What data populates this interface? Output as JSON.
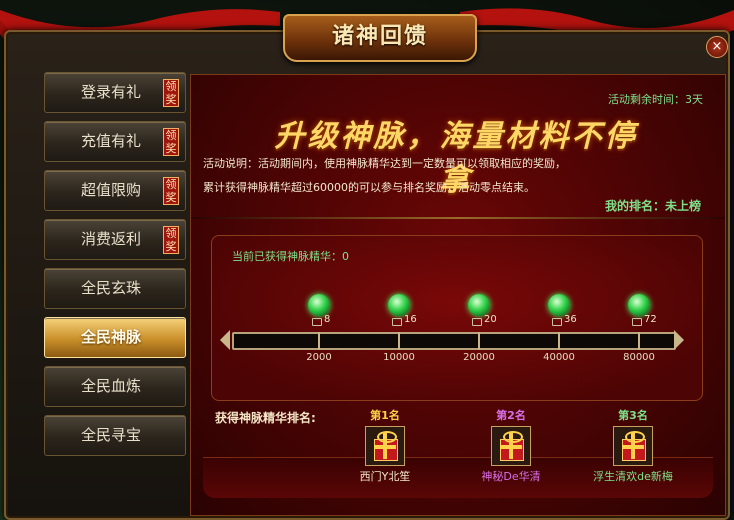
{
  "window": {
    "title": "诸神回馈",
    "close_glyph": "×"
  },
  "sidebar": {
    "items": [
      {
        "label": "登录有礼",
        "tag": "领奖",
        "active": false
      },
      {
        "label": "充值有礼",
        "tag": "领奖",
        "active": false
      },
      {
        "label": "超值限购",
        "tag": "领奖",
        "active": false
      },
      {
        "label": "消费返利",
        "tag": "领奖",
        "active": false
      },
      {
        "label": "全民玄珠",
        "tag": "",
        "active": false
      },
      {
        "label": "全民神脉",
        "tag": "",
        "active": true
      },
      {
        "label": "全民血炼",
        "tag": "",
        "active": false
      },
      {
        "label": "全民寻宝",
        "tag": "",
        "active": false
      }
    ]
  },
  "event": {
    "remaining_time": "活动剩余时间：3天",
    "slogan": "升级神脉，海量材料不停拿",
    "desc_line1": "活动说明：活动期间内，使用神脉精华达到一定数量可以领取相应的奖励，",
    "desc_line2": "累计获得神脉精华超过60000的可以参与排名奖励，活动零点结束。",
    "my_rank": "我的排名：未上榜",
    "current_label": "当前已获得神脉精华：0",
    "progress": 0,
    "milestones": [
      {
        "gem_count": "8",
        "threshold": "2000"
      },
      {
        "gem_count": "16",
        "threshold": "10000"
      },
      {
        "gem_count": "20",
        "threshold": "20000"
      },
      {
        "gem_count": "36",
        "threshold": "40000"
      },
      {
        "gem_count": "72",
        "threshold": "80000"
      }
    ]
  },
  "ranking": {
    "title": "获得神脉精华排名:",
    "slots": [
      {
        "place": "第1名",
        "player": "西门Y北笙",
        "place_color": "#ffd24a",
        "player_color": "#f3e7cc"
      },
      {
        "place": "第2名",
        "player": "神秘De华清",
        "place_color": "#d96ee8",
        "player_color": "#d96ee8"
      },
      {
        "place": "第3名",
        "player": "浮生清欢de新梅",
        "place_color": "#7fe08a",
        "player_color": "#7fe08a"
      }
    ]
  },
  "colors": {
    "accent_gold": "#ffd766",
    "status_green": "#7fe08a",
    "panel_red": "#6b0606"
  }
}
